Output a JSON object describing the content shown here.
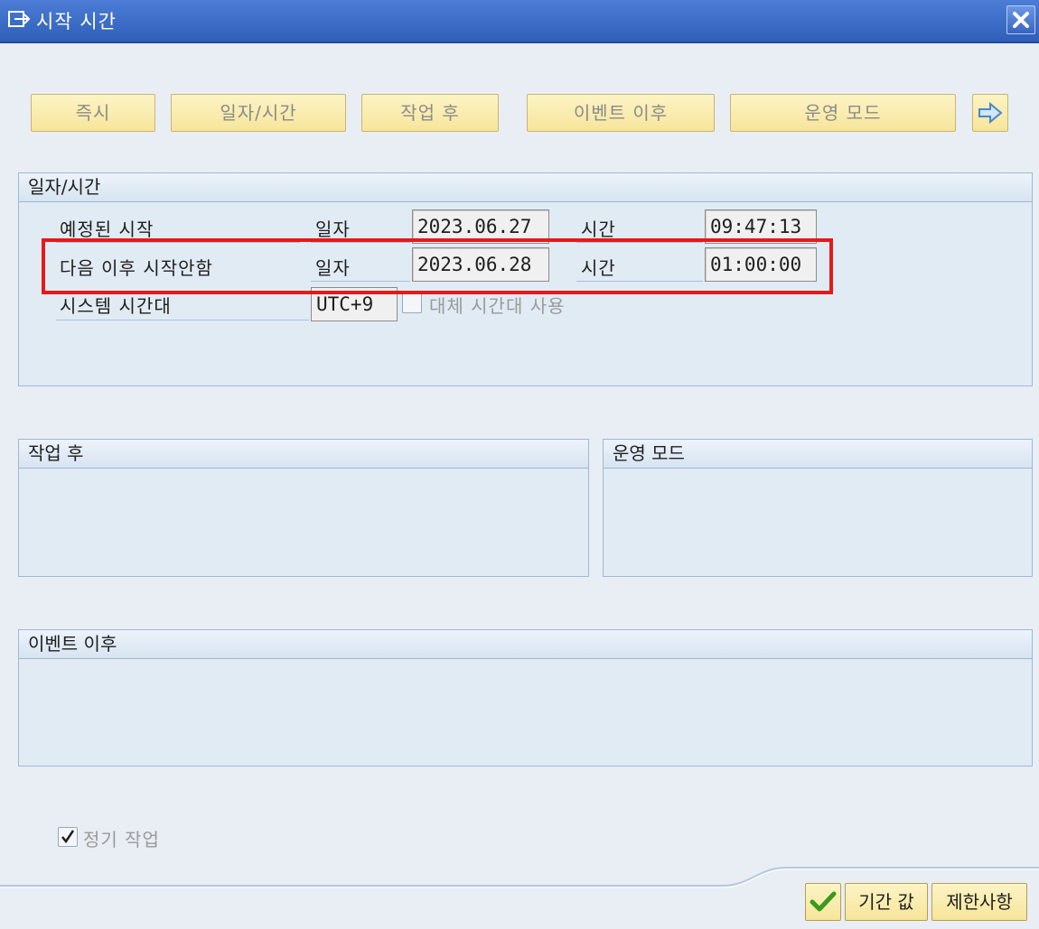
{
  "window": {
    "title": "시작 시간",
    "title_icon": "window-icon",
    "close_icon": "close-icon"
  },
  "toolbar": {
    "immediate": "즉시",
    "date_time": "일자/시간",
    "after_job": "작업 후",
    "after_event": "이벤트 이후",
    "operation_mode": "운영 모드",
    "next_icon": "arrow-right-icon"
  },
  "date_time_group": {
    "header": "일자/시간",
    "scheduled_start": {
      "label": "예정된 시작",
      "date_label": "일자",
      "date": "2023.06.27",
      "time_label": "시간",
      "time": "09:47:13"
    },
    "no_start_after": {
      "label": "다음 이후 시작안함",
      "date_label": "일자",
      "date": "2023.06.28",
      "time_label": "시간",
      "time": "01:00:00"
    },
    "system_timezone": {
      "label": "시스템 시간대",
      "value": "UTC+9",
      "alt_tz_label": "대체 시간대 사용"
    }
  },
  "after_job_group": {
    "header": "작업 후"
  },
  "operation_mode_group": {
    "header": "운영 모드"
  },
  "after_event_group": {
    "header": "이벤트 이후"
  },
  "periodic_job": {
    "label": "정기 작업",
    "checked": true
  },
  "footer": {
    "confirm_icon": "checkmark-icon",
    "period_values": "기간 값",
    "restrictions": "제한사항"
  },
  "colors": {
    "highlight": "#e41a1a",
    "title_bar": "#2f5fb8",
    "button_bg": "#f6e59a"
  }
}
